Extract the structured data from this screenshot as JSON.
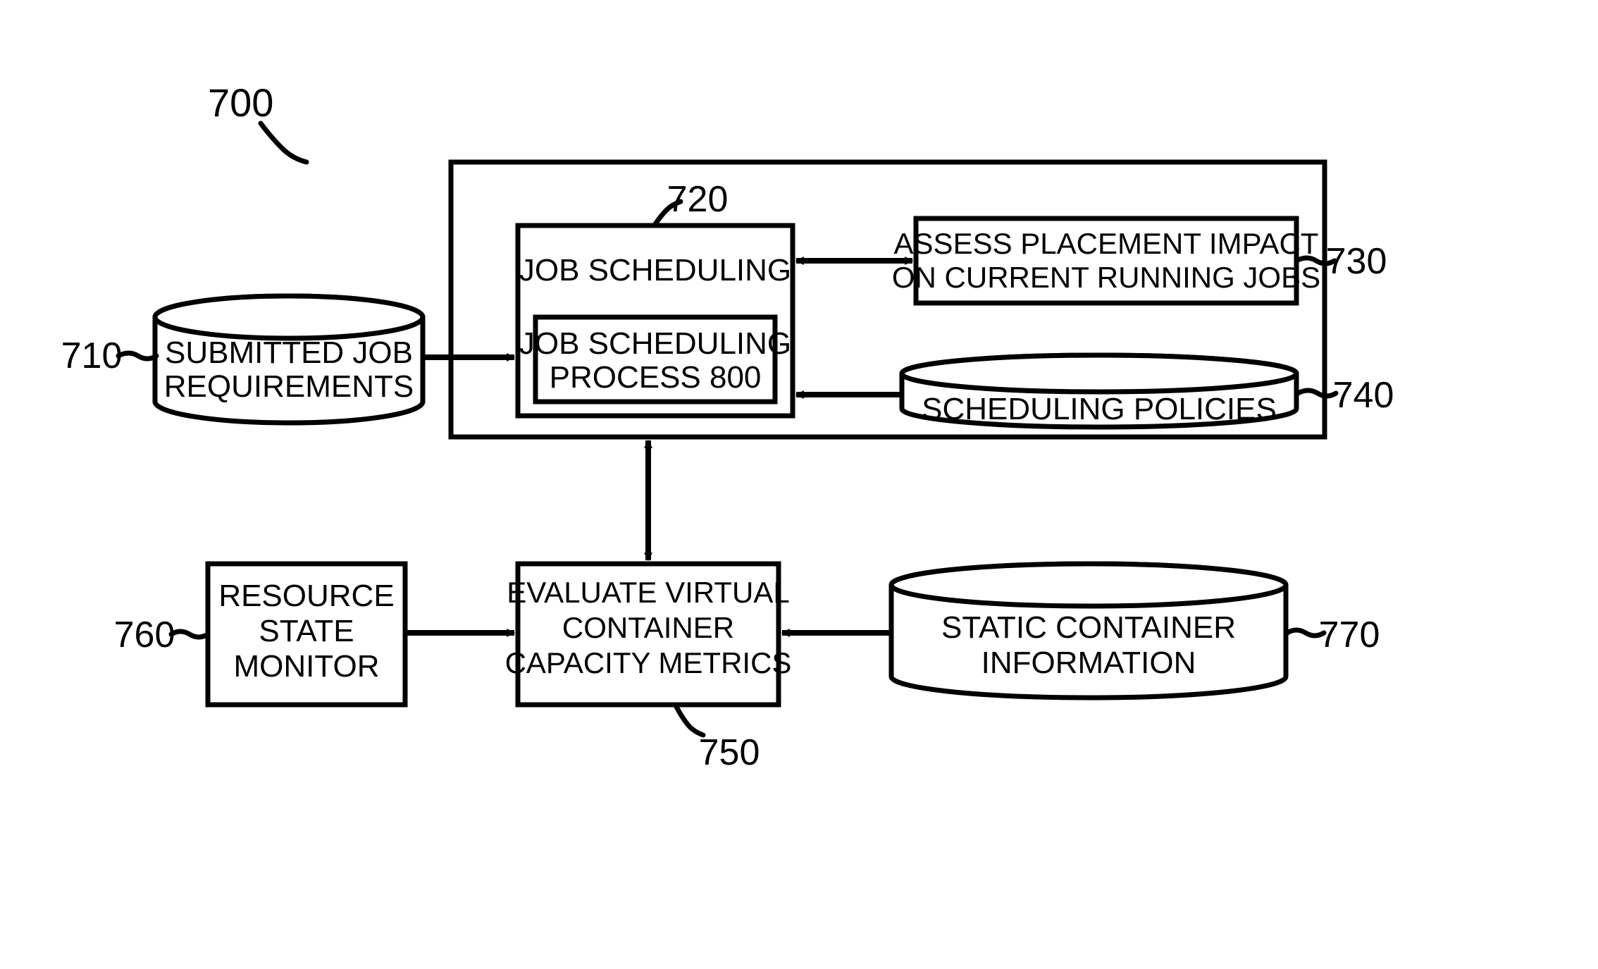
{
  "diagram_ref": "700",
  "labels": {
    "n710": "710",
    "n720": "720",
    "n730": "730",
    "n740": "740",
    "n750": "750",
    "n760": "760",
    "n770": "770"
  },
  "blocks": {
    "submitted_job_requirements_l1": "SUBMITTED JOB",
    "submitted_job_requirements_l2": "REQUIREMENTS",
    "job_scheduling": "JOB SCHEDULING",
    "job_scheduling_process_l1": "JOB SCHEDULING",
    "job_scheduling_process_l2": "PROCESS 800",
    "assess_l1": "ASSESS PLACEMENT IMPACT",
    "assess_l2": "ON CURRENT RUNNING JOBS",
    "scheduling_policies": "SCHEDULING POLICIES",
    "resource_state_monitor_l1": "RESOURCE",
    "resource_state_monitor_l2": "STATE",
    "resource_state_monitor_l3": "MONITOR",
    "evaluate_l1": "EVALUATE VIRTUAL",
    "evaluate_l2": "CONTAINER",
    "evaluate_l3": "CAPACITY METRICS",
    "static_container_l1": "STATIC CONTAINER",
    "static_container_l2": "INFORMATION"
  }
}
